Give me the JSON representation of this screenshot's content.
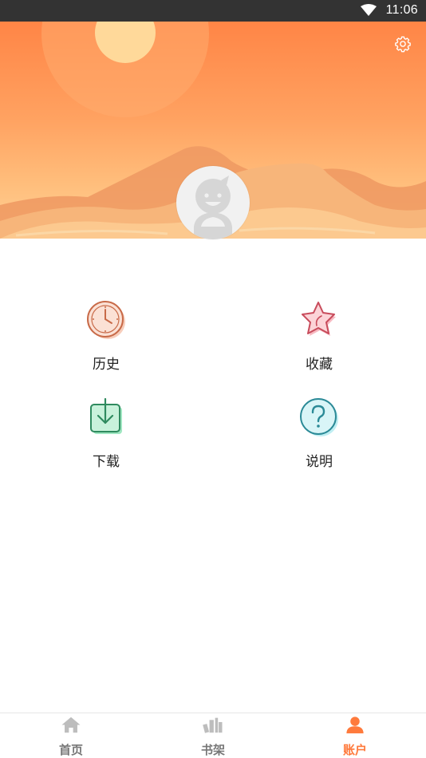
{
  "status_bar": {
    "time": "11:06"
  },
  "header": {
    "settings_icon": "gear-icon",
    "avatar_icon": "default-avatar-icon"
  },
  "menu": [
    {
      "label": "历史",
      "icon": "clock-icon"
    },
    {
      "label": "收藏",
      "icon": "star-icon"
    },
    {
      "label": "下载",
      "icon": "download-icon"
    },
    {
      "label": "说明",
      "icon": "question-icon"
    }
  ],
  "bottom_nav": [
    {
      "label": "首页",
      "icon": "home-icon",
      "active": false
    },
    {
      "label": "书架",
      "icon": "bookshelf-icon",
      "active": false
    },
    {
      "label": "账户",
      "icon": "account-icon",
      "active": true
    }
  ],
  "colors": {
    "accent": "#ff7a3c",
    "inactive": "#777777",
    "status_bar": "#333333"
  }
}
